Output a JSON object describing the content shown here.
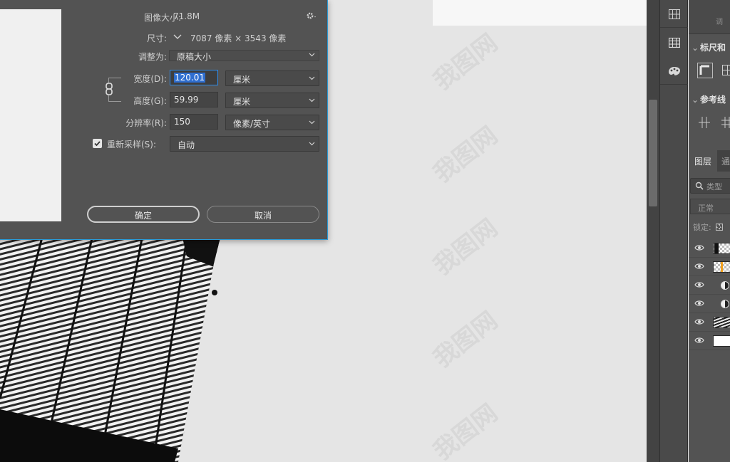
{
  "dialog": {
    "image_size_label": "图像大小:",
    "image_size_value": "71.8M",
    "dimensions_label": "尺寸:",
    "dimensions_value": "7087 像素 × 3543 像素",
    "fit_to_label": "调整为:",
    "fit_to_value": "原稿大小",
    "width_label": "宽度(D):",
    "width_value": "120.01",
    "width_unit": "厘米",
    "height_label": "高度(G):",
    "height_value": "59.99",
    "height_unit": "厘米",
    "resolution_label": "分辨率(R):",
    "resolution_value": "150",
    "resolution_unit": "像素/英寸",
    "resample_label": "重新采样(S):",
    "resample_checked": true,
    "resample_value": "自动",
    "ok_label": "确定",
    "cancel_label": "取消"
  },
  "canvas": {
    "watermark_text": "我图网"
  },
  "panel": {
    "top_partial_text": "调",
    "rulers_title": "标尺和",
    "guides_title": "参考线",
    "layers_tab": "图层",
    "channels_tab": "通",
    "search_placeholder": "类型",
    "blend_mode": "正常",
    "lock_label": "锁定:",
    "layers": [
      {
        "type": "bitmap-thumb"
      },
      {
        "type": "orange-thumb"
      },
      {
        "type": "adjustment"
      },
      {
        "type": "adjustment"
      },
      {
        "type": "photo-thumb"
      },
      {
        "type": "white-thumb"
      }
    ]
  },
  "colors": {
    "dialog_bg": "#535353",
    "accent_focus": "#2d8ceb",
    "selection": "#2e6ed0",
    "panel_bg": "#535353"
  }
}
